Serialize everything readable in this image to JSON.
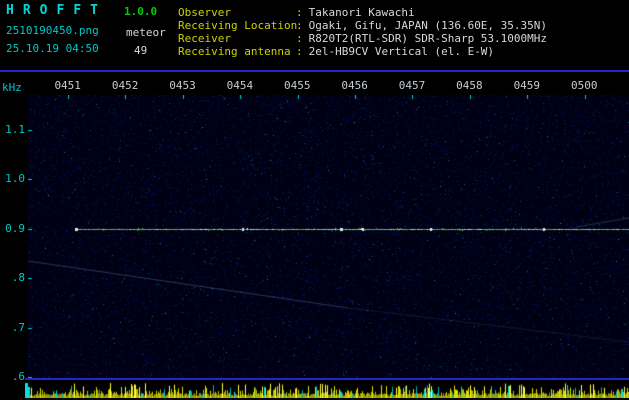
{
  "header": {
    "title_letters": [
      "H",
      "R",
      "O",
      "F",
      "F",
      "T"
    ],
    "version": "1.0.0",
    "filename": "2510190450.png",
    "mode": "meteor",
    "timestamp": "25.10.19 04:50",
    "count": "49"
  },
  "info": {
    "colon": ":",
    "rows": [
      {
        "label": "Observer",
        "value": "Takanori Kawachi"
      },
      {
        "label": "Receiving Location",
        "value": "Ogaki, Gifu, JAPAN (136.60E, 35.35N)"
      },
      {
        "label": "Receiver",
        "value": "R820T2(RTL-SDR) SDR-Sharp 53.1000MHz"
      },
      {
        "label": "Receiving antenna",
        "value": "2el-HB9CV Vertical (el. E-W)"
      }
    ]
  },
  "spectrogram": {
    "unit_label": "kHz",
    "time_labels": [
      "0451",
      "0452",
      "0453",
      "0454",
      "0455",
      "0456",
      "0457",
      "0458",
      "0459",
      "0500"
    ],
    "freq_labels": [
      "1.1",
      "1.0",
      "0.9",
      ".8",
      ".7",
      ".6"
    ],
    "signal_freq_khz": 0.9,
    "colors": {
      "background": "#000014",
      "signal": "#78eb78",
      "axis": "#00cccc",
      "activity": "#c8c800",
      "grid_line": "#1c27cc"
    }
  }
}
